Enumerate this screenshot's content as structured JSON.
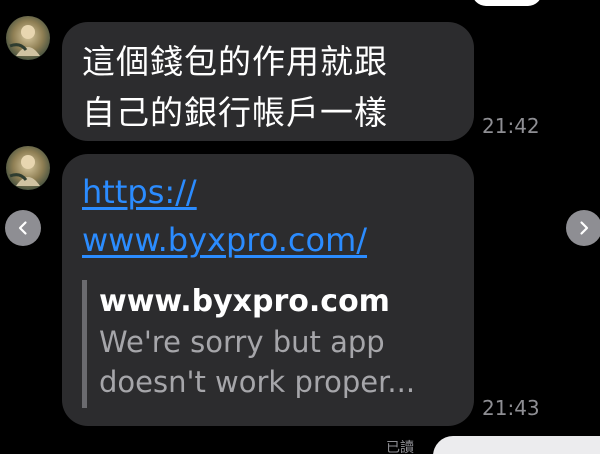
{
  "chat": {
    "messages": [
      {
        "lines": [
          "這個錢包的作用就跟",
          "自己的銀行帳戶一樣"
        ],
        "time": "21:42"
      },
      {
        "link_lines": [
          "https://",
          "www.byxpro.com/"
        ],
        "preview_title": "www.byxpro.com",
        "preview_desc_lines": [
          "We're sorry but app",
          "doesn't work proper..."
        ],
        "time": "21:43"
      }
    ],
    "read_status": "已讀"
  },
  "icons": {
    "prev": "chevron-left-icon",
    "next": "chevron-right-icon"
  },
  "colors": {
    "background": "#000000",
    "bubble": "#2c2c2e",
    "link": "#2b8cff",
    "timestamp": "#8e8e93"
  }
}
